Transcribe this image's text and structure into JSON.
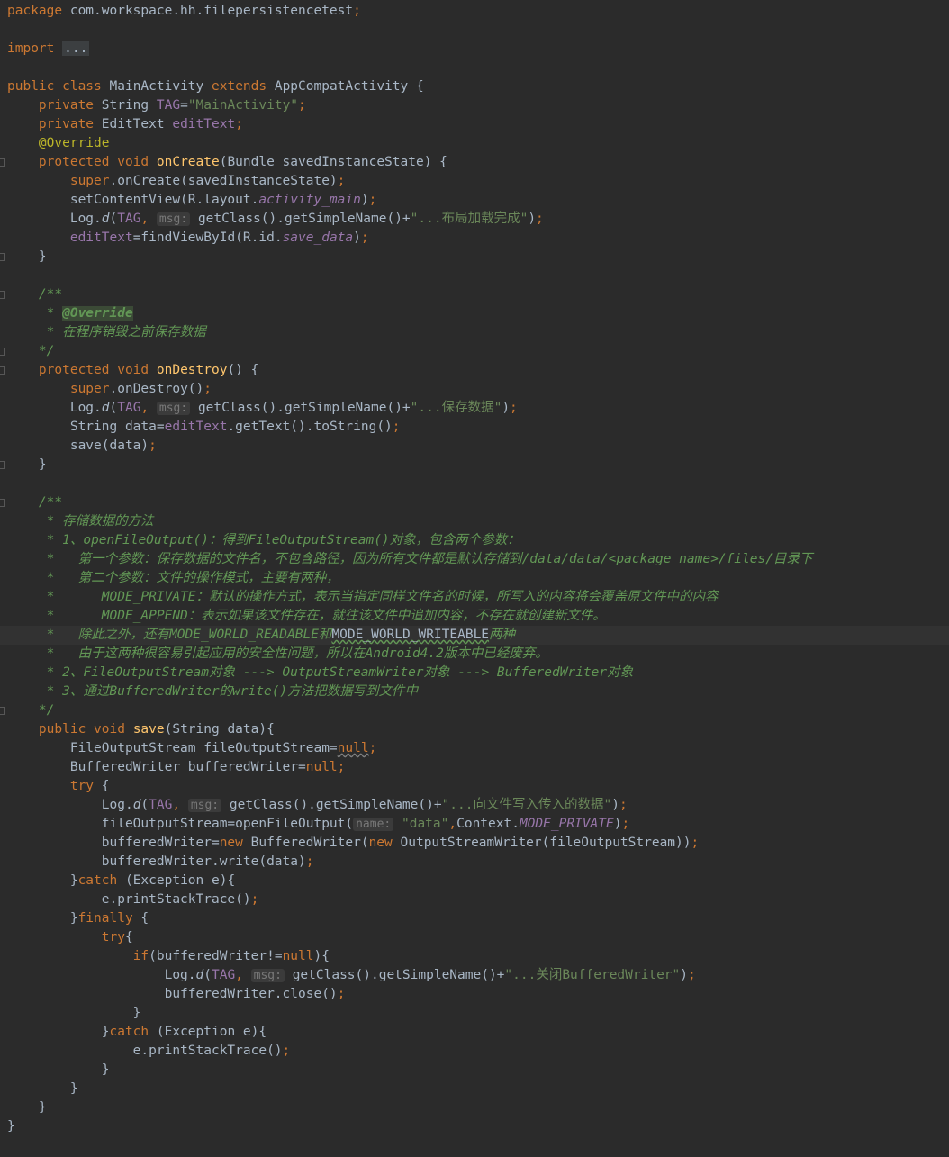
{
  "editor": {
    "lines": [
      [
        {
          "t": "package ",
          "c": "kw"
        },
        {
          "t": "com.workspace.hh.filepersistencetest",
          "c": "plain"
        },
        {
          "t": ";",
          "c": "kw"
        }
      ],
      [],
      [
        {
          "t": "import ",
          "c": "kw"
        },
        {
          "t": "...",
          "c": "fold-box"
        }
      ],
      [],
      [
        {
          "t": "public class ",
          "c": "kw"
        },
        {
          "t": "MainActivity ",
          "c": "plain"
        },
        {
          "t": "extends ",
          "c": "kw"
        },
        {
          "t": "AppCompatActivity {",
          "c": "plain"
        }
      ],
      [
        {
          "t": "    private ",
          "c": "kw"
        },
        {
          "t": "String ",
          "c": "plain"
        },
        {
          "t": "TAG",
          "c": "fld"
        },
        {
          "t": "=",
          "c": "plain"
        },
        {
          "t": "\"MainActivity\"",
          "c": "str"
        },
        {
          "t": ";",
          "c": "kw"
        }
      ],
      [
        {
          "t": "    private ",
          "c": "kw"
        },
        {
          "t": "EditText ",
          "c": "plain"
        },
        {
          "t": "editText",
          "c": "fld"
        },
        {
          "t": ";",
          "c": "kw"
        }
      ],
      [
        {
          "t": "    @Override",
          "c": "ann"
        }
      ],
      [
        {
          "t": "    protected void ",
          "c": "kw"
        },
        {
          "t": "onCreate",
          "c": "fn"
        },
        {
          "t": "(Bundle savedInstanceState) {",
          "c": "plain"
        }
      ],
      [
        {
          "t": "        super",
          "c": "kw"
        },
        {
          "t": ".onCreate(savedInstanceState)",
          "c": "plain"
        },
        {
          "t": ";",
          "c": "kw"
        }
      ],
      [
        {
          "t": "        setContentView(R.layout.",
          "c": "plain"
        },
        {
          "t": "activity_main",
          "c": "fldi"
        },
        {
          "t": ")",
          "c": "plain"
        },
        {
          "t": ";",
          "c": "kw"
        }
      ],
      [
        {
          "t": "        Log.",
          "c": "plain"
        },
        {
          "t": "d",
          "c": "itl"
        },
        {
          "t": "(",
          "c": "plain"
        },
        {
          "t": "TAG",
          "c": "fld"
        },
        {
          "t": ", ",
          "c": "kw"
        },
        {
          "t": "msg:",
          "c": "hint"
        },
        {
          "t": " getClass().getSimpleName()+",
          "c": "plain"
        },
        {
          "t": "\"...布局加载完成\"",
          "c": "str"
        },
        {
          "t": ")",
          "c": "plain"
        },
        {
          "t": ";",
          "c": "kw"
        }
      ],
      [
        {
          "t": "        editText",
          "c": "fld"
        },
        {
          "t": "=findViewById(R.id.",
          "c": "plain"
        },
        {
          "t": "save_data",
          "c": "fldi"
        },
        {
          "t": ")",
          "c": "plain"
        },
        {
          "t": ";",
          "c": "kw"
        }
      ],
      [
        {
          "t": "    }",
          "c": "plain"
        }
      ],
      [],
      [
        {
          "t": "    /**",
          "c": "doc"
        }
      ],
      [
        {
          "t": "     * ",
          "c": "doc"
        },
        {
          "t": "@Override",
          "c": "docfold"
        }
      ],
      [
        {
          "t": "     * 在程序销毁之前保存数据",
          "c": "doc"
        }
      ],
      [
        {
          "t": "    */",
          "c": "doc"
        }
      ],
      [
        {
          "t": "    protected void ",
          "c": "kw"
        },
        {
          "t": "onDestroy",
          "c": "fn"
        },
        {
          "t": "() {",
          "c": "plain"
        }
      ],
      [
        {
          "t": "        super",
          "c": "kw"
        },
        {
          "t": ".onDestroy()",
          "c": "plain"
        },
        {
          "t": ";",
          "c": "kw"
        }
      ],
      [
        {
          "t": "        Log.",
          "c": "plain"
        },
        {
          "t": "d",
          "c": "itl"
        },
        {
          "t": "(",
          "c": "plain"
        },
        {
          "t": "TAG",
          "c": "fld"
        },
        {
          "t": ", ",
          "c": "kw"
        },
        {
          "t": "msg:",
          "c": "hint"
        },
        {
          "t": " getClass().getSimpleName()+",
          "c": "plain"
        },
        {
          "t": "\"...保存数据\"",
          "c": "str"
        },
        {
          "t": ")",
          "c": "plain"
        },
        {
          "t": ";",
          "c": "kw"
        }
      ],
      [
        {
          "t": "        String data=",
          "c": "plain"
        },
        {
          "t": "editText",
          "c": "fld"
        },
        {
          "t": ".getText().toString()",
          "c": "plain"
        },
        {
          "t": ";",
          "c": "kw"
        }
      ],
      [
        {
          "t": "        save(data)",
          "c": "plain"
        },
        {
          "t": ";",
          "c": "kw"
        }
      ],
      [
        {
          "t": "    }",
          "c": "plain"
        }
      ],
      [],
      [
        {
          "t": "    /**",
          "c": "doc"
        }
      ],
      [
        {
          "t": "     * 存储数据的方法",
          "c": "doc"
        }
      ],
      [
        {
          "t": "     * 1、openFileOutput()：得到FileOutputStream()对象，包含两个参数：",
          "c": "doc"
        }
      ],
      [
        {
          "t": "     *   第一个参数：保存数据的文件名，不包含路径，因为所有文件都是默认存储到/data/data/",
          "c": "doc"
        },
        {
          "t": "<package name>",
          "c": "doct"
        },
        {
          "t": "/files/目录下",
          "c": "doc"
        }
      ],
      [
        {
          "t": "     *   第二个参数：文件的操作模式，主要有两种，",
          "c": "doc"
        }
      ],
      [
        {
          "t": "     *      MODE_PRIVATE：默认的操作方式，表示当指定同样文件名的时候，所写入的内容将会覆盖原文件中的内容",
          "c": "doc"
        }
      ],
      [
        {
          "t": "     *      MODE_APPEND：表示如果该文件存在，就往该文件中追加内容，不存在就创建新文件。",
          "c": "doc"
        }
      ],
      [
        {
          "t": "     *   除此之外，还有MODE_WORLD_READABLE和",
          "c": "doc"
        },
        {
          "t": "MODE_WORLD_WRITEABLE",
          "c": "wavy"
        },
        {
          "t": "两种",
          "c": "doc"
        }
      ],
      [
        {
          "t": "     *   由于这两种很容易引起应用的安全性问题，所以在Android4.2版本中已经废弃。",
          "c": "doc"
        }
      ],
      [
        {
          "t": "     * 2、FileOutputStream对象 ---> OutputStreamWriter对象 ---> BufferedWriter对象",
          "c": "doc"
        }
      ],
      [
        {
          "t": "     * 3、通过BufferedWriter的write()方法把数据写到文件中",
          "c": "doc"
        }
      ],
      [
        {
          "t": "    */",
          "c": "doc"
        }
      ],
      [
        {
          "t": "    public void ",
          "c": "kw"
        },
        {
          "t": "save",
          "c": "fn"
        },
        {
          "t": "(String data){",
          "c": "plain"
        }
      ],
      [
        {
          "t": "        FileOutputStream fileOutputStream=",
          "c": "plain"
        },
        {
          "t": "null",
          "c": "kw warn"
        },
        {
          "t": ";",
          "c": "kw"
        }
      ],
      [
        {
          "t": "        BufferedWriter bufferedWriter=",
          "c": "plain"
        },
        {
          "t": "null",
          "c": "kw"
        },
        {
          "t": ";",
          "c": "kw"
        }
      ],
      [
        {
          "t": "        try ",
          "c": "kw"
        },
        {
          "t": "{",
          "c": "plain"
        }
      ],
      [
        {
          "t": "            Log.",
          "c": "plain"
        },
        {
          "t": "d",
          "c": "itl"
        },
        {
          "t": "(",
          "c": "plain"
        },
        {
          "t": "TAG",
          "c": "fld"
        },
        {
          "t": ", ",
          "c": "kw"
        },
        {
          "t": "msg:",
          "c": "hint"
        },
        {
          "t": " getClass().getSimpleName()+",
          "c": "plain"
        },
        {
          "t": "\"...向文件写入传入的数据\"",
          "c": "str"
        },
        {
          "t": ")",
          "c": "plain"
        },
        {
          "t": ";",
          "c": "kw"
        }
      ],
      [
        {
          "t": "            fileOutputStream=openFileOutput(",
          "c": "plain"
        },
        {
          "t": "name:",
          "c": "hint"
        },
        {
          "t": " ",
          "c": "plain"
        },
        {
          "t": "\"data\"",
          "c": "str"
        },
        {
          "t": ",",
          "c": "kw"
        },
        {
          "t": "Context.",
          "c": "plain"
        },
        {
          "t": "MODE_PRIVATE",
          "c": "fldi"
        },
        {
          "t": ")",
          "c": "plain"
        },
        {
          "t": ";",
          "c": "kw"
        }
      ],
      [
        {
          "t": "            bufferedWriter=",
          "c": "plain"
        },
        {
          "t": "new ",
          "c": "kw"
        },
        {
          "t": "BufferedWriter(",
          "c": "plain"
        },
        {
          "t": "new ",
          "c": "kw"
        },
        {
          "t": "OutputStreamWriter(fileOutputStream))",
          "c": "plain"
        },
        {
          "t": ";",
          "c": "kw"
        }
      ],
      [
        {
          "t": "            bufferedWriter.write(data)",
          "c": "plain"
        },
        {
          "t": ";",
          "c": "kw"
        }
      ],
      [
        {
          "t": "        }",
          "c": "plain"
        },
        {
          "t": "catch ",
          "c": "kw"
        },
        {
          "t": "(Exception e){",
          "c": "plain"
        }
      ],
      [
        {
          "t": "            e.printStackTrace()",
          "c": "plain"
        },
        {
          "t": ";",
          "c": "kw"
        }
      ],
      [
        {
          "t": "        }",
          "c": "plain"
        },
        {
          "t": "finally ",
          "c": "kw"
        },
        {
          "t": "{",
          "c": "plain"
        }
      ],
      [
        {
          "t": "            try",
          "c": "kw"
        },
        {
          "t": "{",
          "c": "plain"
        }
      ],
      [
        {
          "t": "                ",
          "c": "plain"
        },
        {
          "t": "if",
          "c": "kw"
        },
        {
          "t": "(bufferedWriter!=",
          "c": "plain"
        },
        {
          "t": "null",
          "c": "kw"
        },
        {
          "t": "){",
          "c": "plain"
        }
      ],
      [
        {
          "t": "                    Log.",
          "c": "plain"
        },
        {
          "t": "d",
          "c": "itl"
        },
        {
          "t": "(",
          "c": "plain"
        },
        {
          "t": "TAG",
          "c": "fld"
        },
        {
          "t": ", ",
          "c": "kw"
        },
        {
          "t": "msg:",
          "c": "hint"
        },
        {
          "t": " getClass().getSimpleName()+",
          "c": "plain"
        },
        {
          "t": "\"...关闭BufferedWriter\"",
          "c": "str"
        },
        {
          "t": ")",
          "c": "plain"
        },
        {
          "t": ";",
          "c": "kw"
        }
      ],
      [
        {
          "t": "                    bufferedWriter.close()",
          "c": "plain"
        },
        {
          "t": ";",
          "c": "kw"
        }
      ],
      [
        {
          "t": "                }",
          "c": "plain"
        }
      ],
      [
        {
          "t": "            }",
          "c": "plain"
        },
        {
          "t": "catch ",
          "c": "kw"
        },
        {
          "t": "(Exception e){",
          "c": "plain"
        }
      ],
      [
        {
          "t": "                e.printStackTrace()",
          "c": "plain"
        },
        {
          "t": ";",
          "c": "kw"
        }
      ],
      [
        {
          "t": "            }",
          "c": "plain"
        }
      ],
      [
        {
          "t": "        }",
          "c": "plain"
        }
      ],
      [
        {
          "t": "    }",
          "c": "plain"
        }
      ],
      [
        {
          "t": "}",
          "c": "plain"
        }
      ]
    ],
    "caret_line": 33,
    "fold_marker_lines": [
      8,
      13,
      15,
      18,
      19,
      24,
      26,
      37
    ]
  }
}
